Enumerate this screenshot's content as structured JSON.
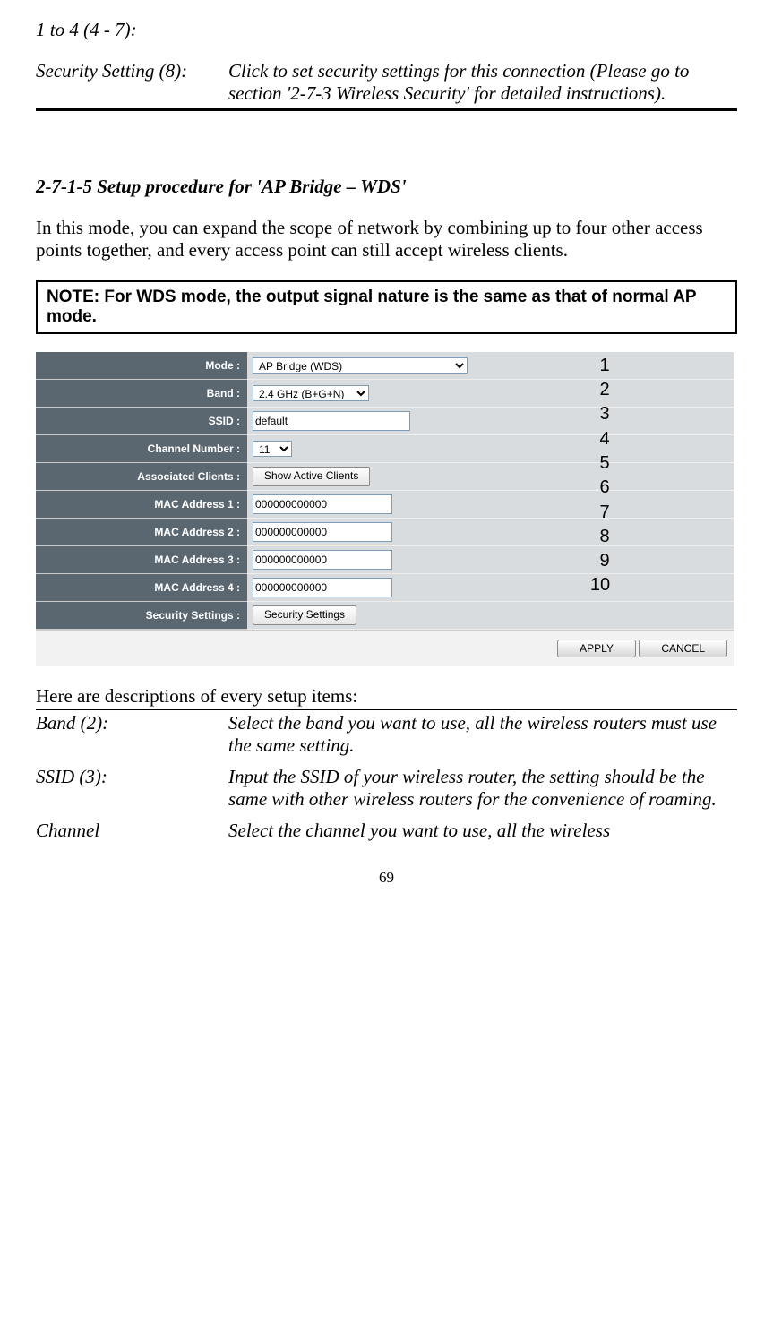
{
  "top_fragment_label": "1 to 4 (4 - 7):",
  "security_term": "Security Setting (8):",
  "security_desc": "Click to set security settings for this connection (Please go to section '2-7-3 Wireless Security' for detailed instructions).",
  "section_heading": "2-7-1-5 Setup procedure for 'AP Bridge – WDS'",
  "section_intro": "In this mode, you can expand the scope of network by combining up to four other access points together, and every access point can still accept wireless clients.",
  "note": "NOTE: For WDS mode, the output signal nature is the same as that of normal AP mode.",
  "ui": {
    "labels": {
      "mode": "Mode :",
      "band": "Band :",
      "ssid": "SSID :",
      "channel": "Channel Number :",
      "assoc": "Associated Clients :",
      "mac1": "MAC Address 1 :",
      "mac2": "MAC Address 2 :",
      "mac3": "MAC Address 3 :",
      "mac4": "MAC Address 4 :",
      "security": "Security Settings :"
    },
    "values": {
      "mode": "AP Bridge (WDS)",
      "band": "2.4 GHz (B+G+N)",
      "ssid": "default",
      "channel": "11",
      "mac1": "000000000000",
      "mac2": "000000000000",
      "mac3": "000000000000",
      "mac4": "000000000000"
    },
    "buttons": {
      "show_clients": "Show Active Clients",
      "security_settings": "Security Settings",
      "apply": "APPLY",
      "cancel": "CANCEL"
    },
    "annotations": [
      "1",
      "2",
      "3",
      "4",
      "5",
      "6",
      "7",
      "8",
      "9",
      "10"
    ]
  },
  "desc_intro": "Here are descriptions of every setup items:",
  "items": {
    "band_term": "Band (2):",
    "band_desc": "Select the band you want to use, all the wireless routers must use the same setting.",
    "ssid_term": "SSID (3):",
    "ssid_desc": "Input the SSID of your wireless router, the setting should be the same with other wireless routers for the convenience of roaming.",
    "channel_term": "Channel",
    "channel_desc": "Select the channel you want to use, all the wireless"
  },
  "page_number": "69"
}
